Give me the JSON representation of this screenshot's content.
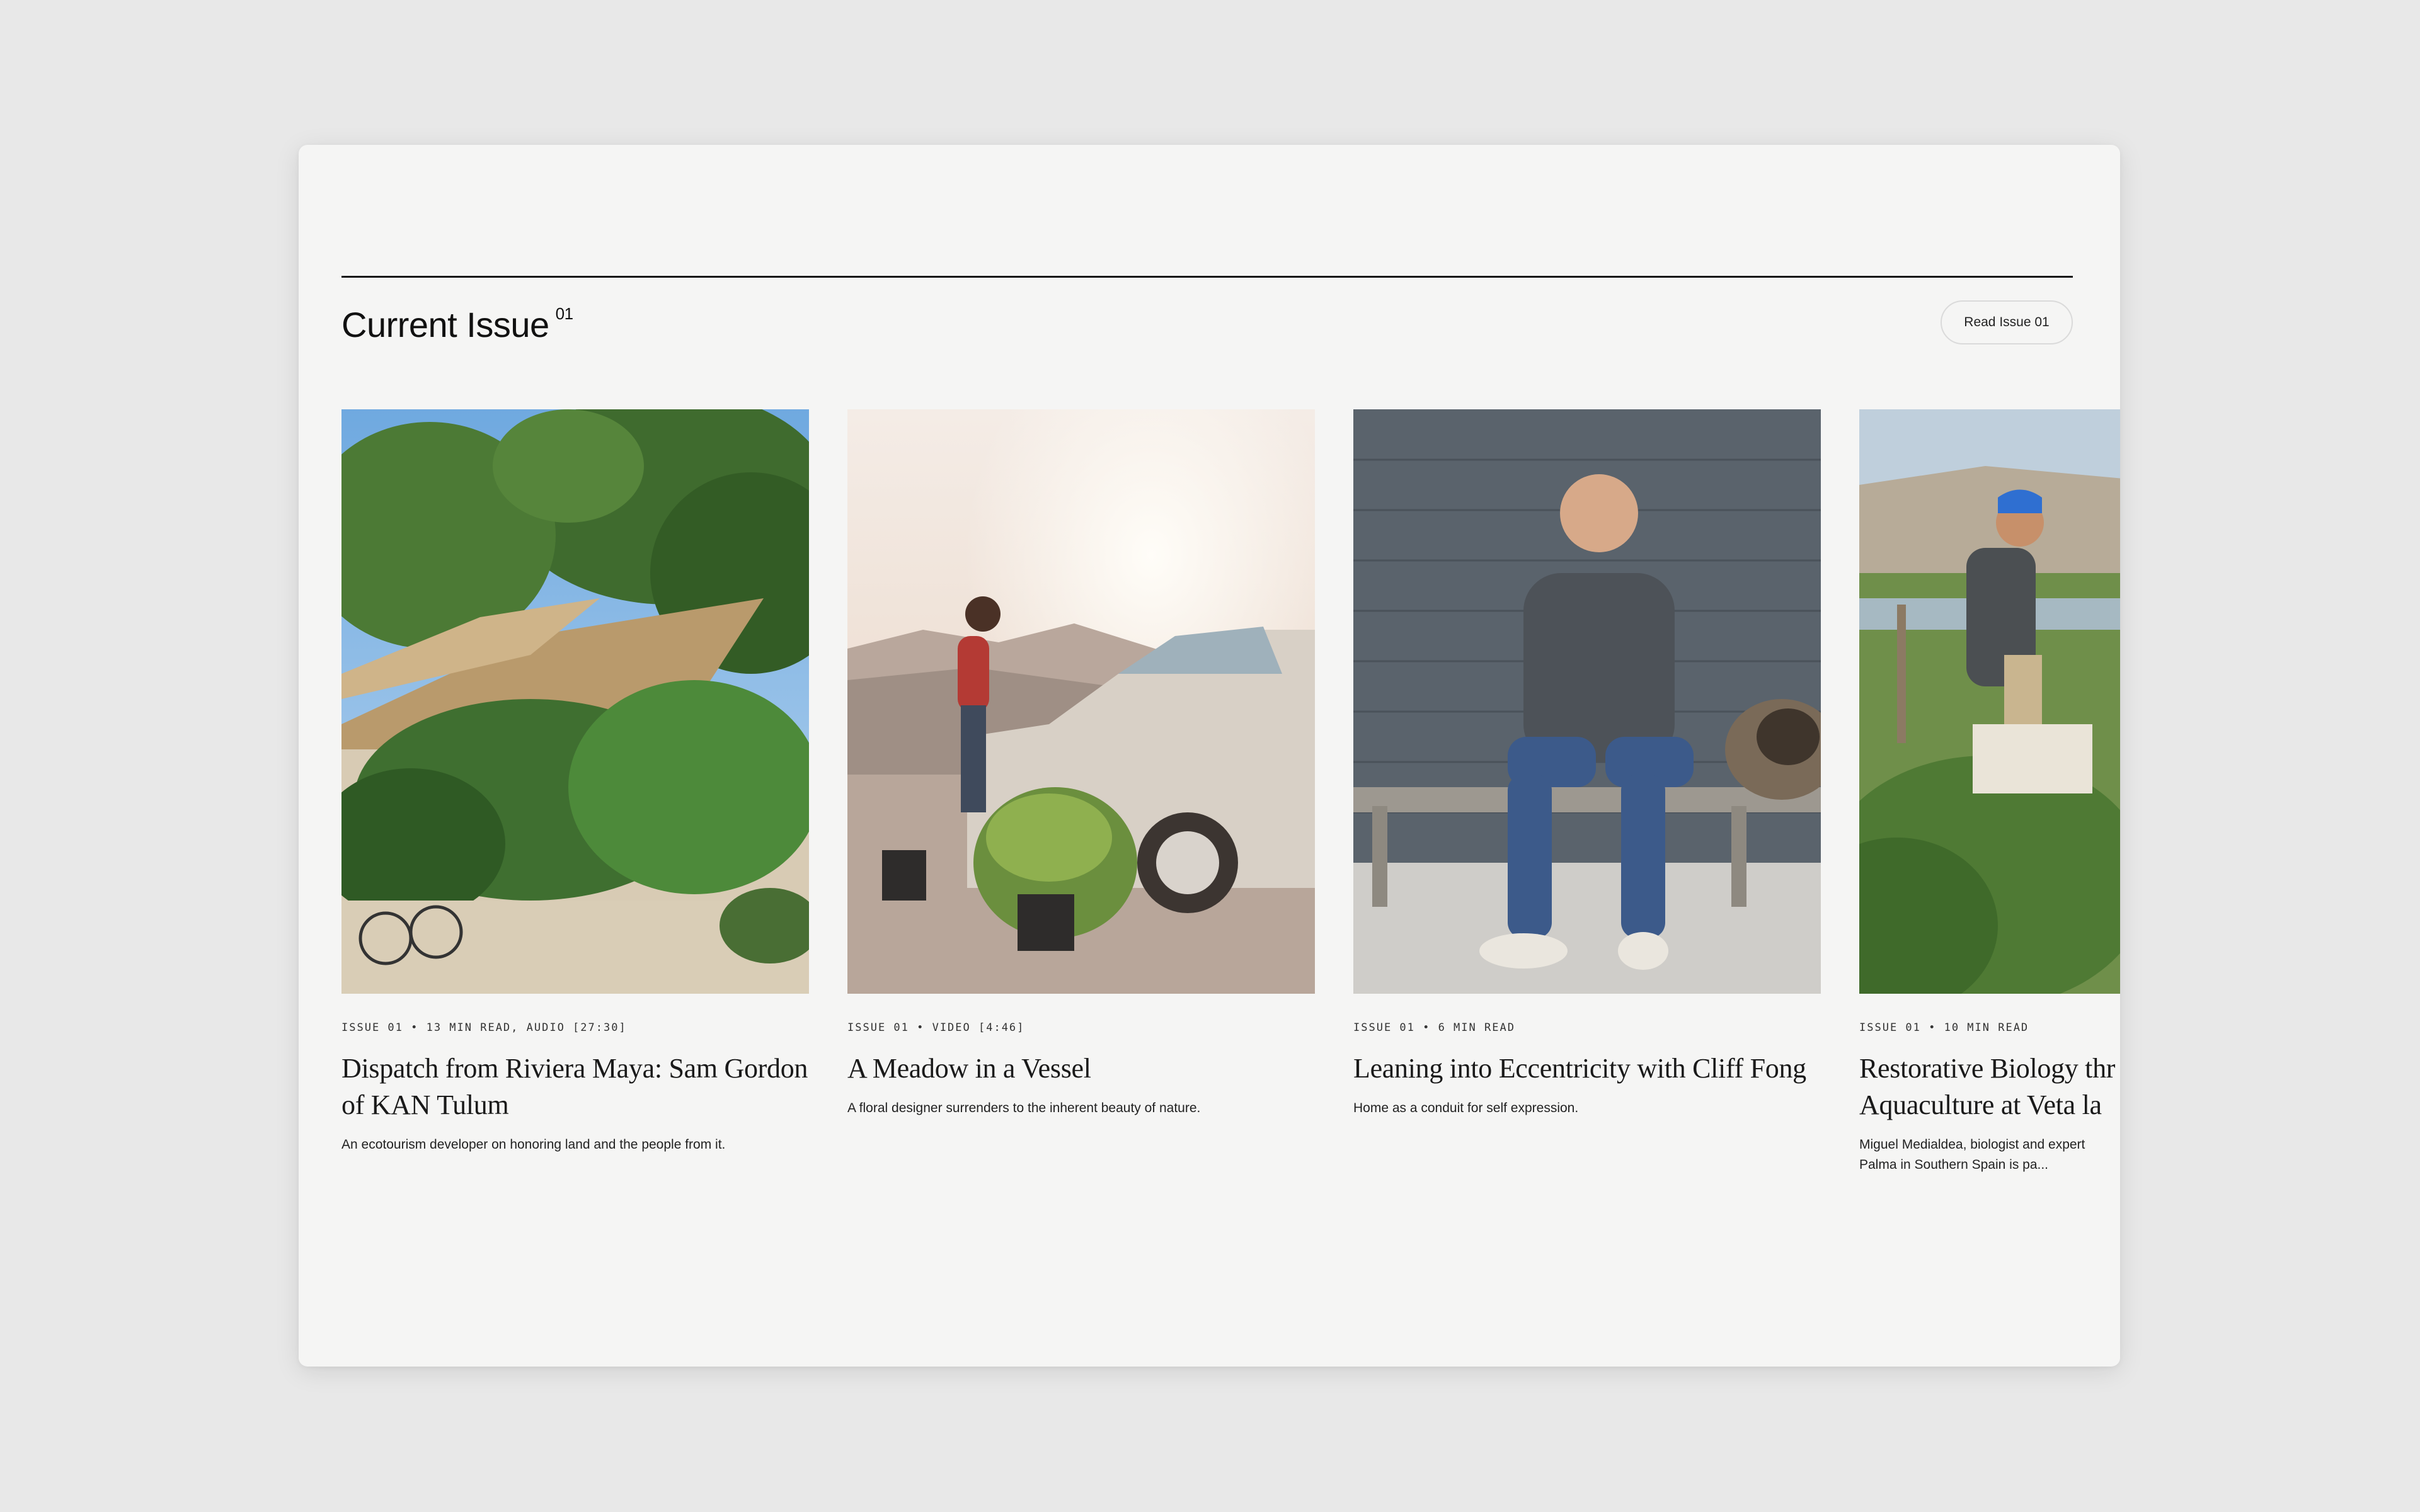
{
  "section": {
    "title": "Current Issue",
    "issue_sup": "01",
    "read_button": "Read Issue 01"
  },
  "cards": [
    {
      "meta": "ISSUE 01 • 13 MIN READ, AUDIO [27:30]",
      "title": "Dispatch from Riviera Maya: Sam Gordon of KAN Tulum",
      "desc": "An ecotourism developer on honoring land and the people from it."
    },
    {
      "meta": "ISSUE 01 • VIDEO [4:46]",
      "title": "A Meadow in a Vessel",
      "desc": "A floral designer surrenders to the inherent beauty of nature."
    },
    {
      "meta": "ISSUE 01 • 6 MIN READ",
      "title": "Leaning into Eccentricity with Cliff Fong",
      "desc": "Home as a conduit for self expression."
    },
    {
      "meta": "ISSUE 01 • 10 MIN READ",
      "title_line1": "Restorative Biology thr",
      "title_line2": "Aquaculture at Veta la",
      "desc_line1": "Miguel Medialdea, biologist and expert",
      "desc_line2": "Palma in Southern Spain is pa..."
    }
  ]
}
